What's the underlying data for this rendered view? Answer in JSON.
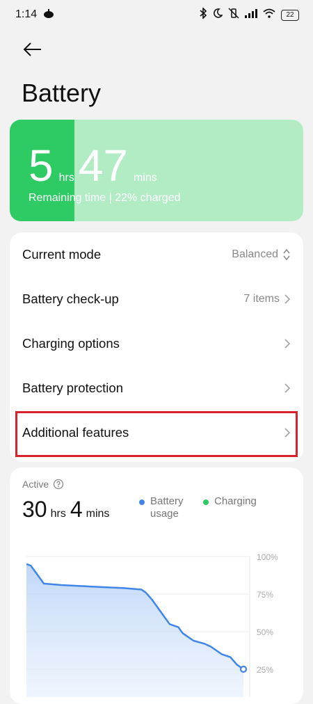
{
  "status_bar": {
    "time": "1:14",
    "battery_level": "22"
  },
  "title": "Battery",
  "battery_card": {
    "hours": "5",
    "hours_unit": "hrs",
    "minutes": "47",
    "minutes_unit": "mins",
    "subtitle": "Remaining time | 22% charged",
    "charge_fraction": 0.22,
    "fill_color": "#2ecb64",
    "bg_color": "#b2ecc5"
  },
  "settings": [
    {
      "label": "Current mode",
      "value": "Balanced",
      "chevron": "up-down"
    },
    {
      "label": "Battery check-up",
      "value": "7 items",
      "chevron": "right"
    },
    {
      "label": "Charging options",
      "value": "",
      "chevron": "right"
    },
    {
      "label": "Battery protection",
      "value": "",
      "chevron": "right"
    },
    {
      "label": "Additional features",
      "value": "",
      "chevron": "right"
    }
  ],
  "active": {
    "label": "Active",
    "hours": "30",
    "hours_unit": "hrs",
    "minutes": "4",
    "minutes_unit": "mins",
    "legend": [
      {
        "name": "Battery usage",
        "line1": "Battery",
        "line2": "usage",
        "color": "#3f86e8"
      },
      {
        "name": "Charging",
        "line1": "Charging",
        "line2": "",
        "color": "#2ecb64"
      }
    ]
  },
  "chart_data": {
    "type": "area",
    "y_ticks": [
      "100%",
      "75%",
      "50%",
      "25%"
    ],
    "ylim": [
      0,
      100
    ],
    "series": [
      {
        "name": "Battery usage",
        "color": "#3f86e8",
        "x": [
          0,
          2,
          5,
          8,
          16,
          30,
          45,
          53,
          55,
          58,
          62,
          66,
          70,
          72,
          77,
          82,
          85,
          90,
          94,
          97,
          100
        ],
        "values": [
          95,
          94,
          88,
          82,
          81,
          80,
          79,
          78,
          76,
          71,
          63,
          55,
          53,
          49,
          44,
          42,
          40,
          35,
          33,
          28,
          25
        ]
      }
    ]
  },
  "colors": {
    "accent": "#3f86e8",
    "highlight_border": "#d8232f"
  }
}
